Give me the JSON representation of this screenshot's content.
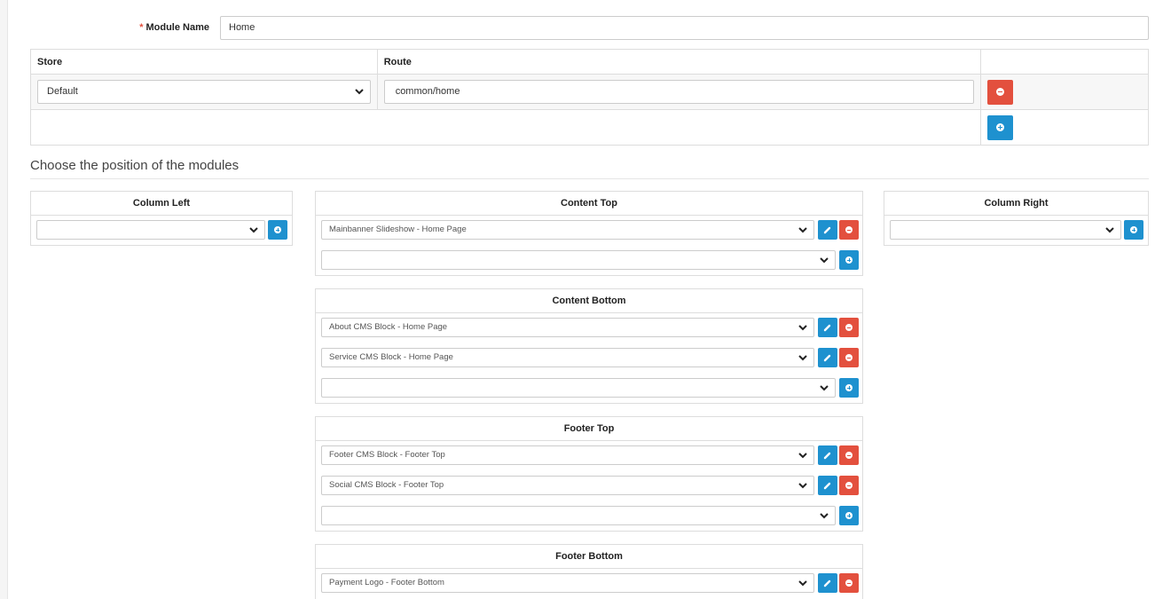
{
  "form": {
    "module_name_label": "Module Name",
    "required_mark": "*",
    "module_name_value": "Home"
  },
  "route_table": {
    "headers": [
      "Store",
      "Route",
      ""
    ],
    "rows": [
      {
        "store": "Default",
        "route": "common/home"
      }
    ]
  },
  "positions": {
    "legend": "Choose the position of the modules",
    "column_left": {
      "title": "Column Left",
      "modules": [],
      "add_select": ""
    },
    "content_top": {
      "title": "Content Top",
      "modules": [
        "Mainbanner Slideshow - Home Page"
      ],
      "add_select": ""
    },
    "content_bottom": {
      "title": "Content Bottom",
      "modules": [
        "About CMS Block - Home Page",
        "Service CMS Block - Home Page"
      ],
      "add_select": ""
    },
    "footer_top": {
      "title": "Footer Top",
      "modules": [
        "Footer CMS Block - Footer Top",
        "Social CMS Block - Footer Top"
      ],
      "add_select": ""
    },
    "footer_bottom": {
      "title": "Footer Bottom",
      "modules": [
        "Payment Logo - Footer Bottom"
      ]
    },
    "column_right": {
      "title": "Column Right",
      "modules": [],
      "add_select": ""
    }
  },
  "colors": {
    "danger": "#e3503e",
    "primary": "#1e91cf"
  },
  "icons": {
    "chevron": "chevron-down-icon",
    "remove": "minus-circle-icon",
    "add": "plus-circle-icon",
    "edit": "pencil-icon"
  }
}
